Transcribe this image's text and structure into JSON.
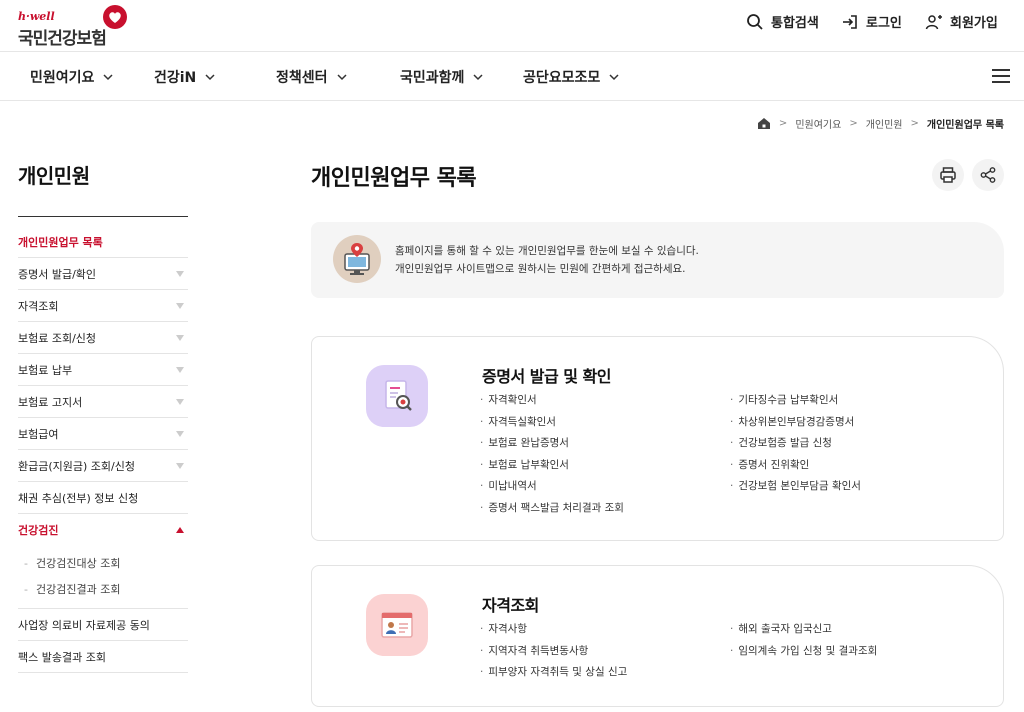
{
  "header": {
    "logo_small": "h·well",
    "logo_main": "국민건강보험",
    "search_label": "통합검색",
    "login_label": "로그인",
    "join_label": "회원가입"
  },
  "gnb": [
    {
      "label": "민원여기요"
    },
    {
      "label": "건강iN"
    },
    {
      "label": "정책센터"
    },
    {
      "label": "국민과함께"
    },
    {
      "label": "공단요모조모"
    }
  ],
  "breadcrumb": {
    "items": [
      "민원여기요",
      "개인민원"
    ],
    "current": "개인민원업무 목록"
  },
  "sidebar": {
    "title": "개인민원",
    "items": [
      {
        "label": "개인민원업무 목록"
      },
      {
        "label": "증명서 발급/확인"
      },
      {
        "label": "자격조회"
      },
      {
        "label": "보험료 조회/신청"
      },
      {
        "label": "보험료 납부"
      },
      {
        "label": "보험료 고지서"
      },
      {
        "label": "보험급여"
      },
      {
        "label": "환급금(지원금) 조회/신청"
      },
      {
        "label": "채권 추심(전부) 정보 신청"
      },
      {
        "label": "건강검진"
      },
      {
        "label": "사업장 의료비 자료제공 동의"
      },
      {
        "label": "팩스 발송결과 조회"
      }
    ],
    "sub_items": [
      {
        "label": "건강검진대상 조회"
      },
      {
        "label": "건강검진결과 조회"
      }
    ]
  },
  "main": {
    "title": "개인민원업무 목록",
    "info_line1": "홈페이지를 통해 할 수 있는 개인민원업무를 한눈에 보실 수 있습니다.",
    "info_line2": "개인민원업무 사이트맵으로 원하시는 민원에 간편하게 접근하세요."
  },
  "cards": [
    {
      "title": "증명서 발급 및 확인",
      "left": [
        "자격확인서",
        "자격득실확인서",
        "보험료 완납증명서",
        "보험료 납부확인서",
        "미납내역서",
        "증명서 팩스발급 처리결과 조회"
      ],
      "right": [
        "기타징수금 납부확인서",
        "차상위본인부담경감증명서",
        "건강보험증 발급 신청",
        "증명서 진위확인",
        "건강보험 본인부담금 확인서"
      ]
    },
    {
      "title": "자격조회",
      "left": [
        "자격사항",
        "지역자격 취득변동사항",
        "피부양자 자격취득 및 상실 신고"
      ],
      "right": [
        "해외 출국자 입국신고",
        "임의계속 가입 신청 및 결과조회"
      ]
    }
  ],
  "colors": {
    "brand_red": "#c8102e",
    "card1_icon_bg": "#ddd0f7",
    "card2_icon_bg": "#fbd2d2"
  }
}
